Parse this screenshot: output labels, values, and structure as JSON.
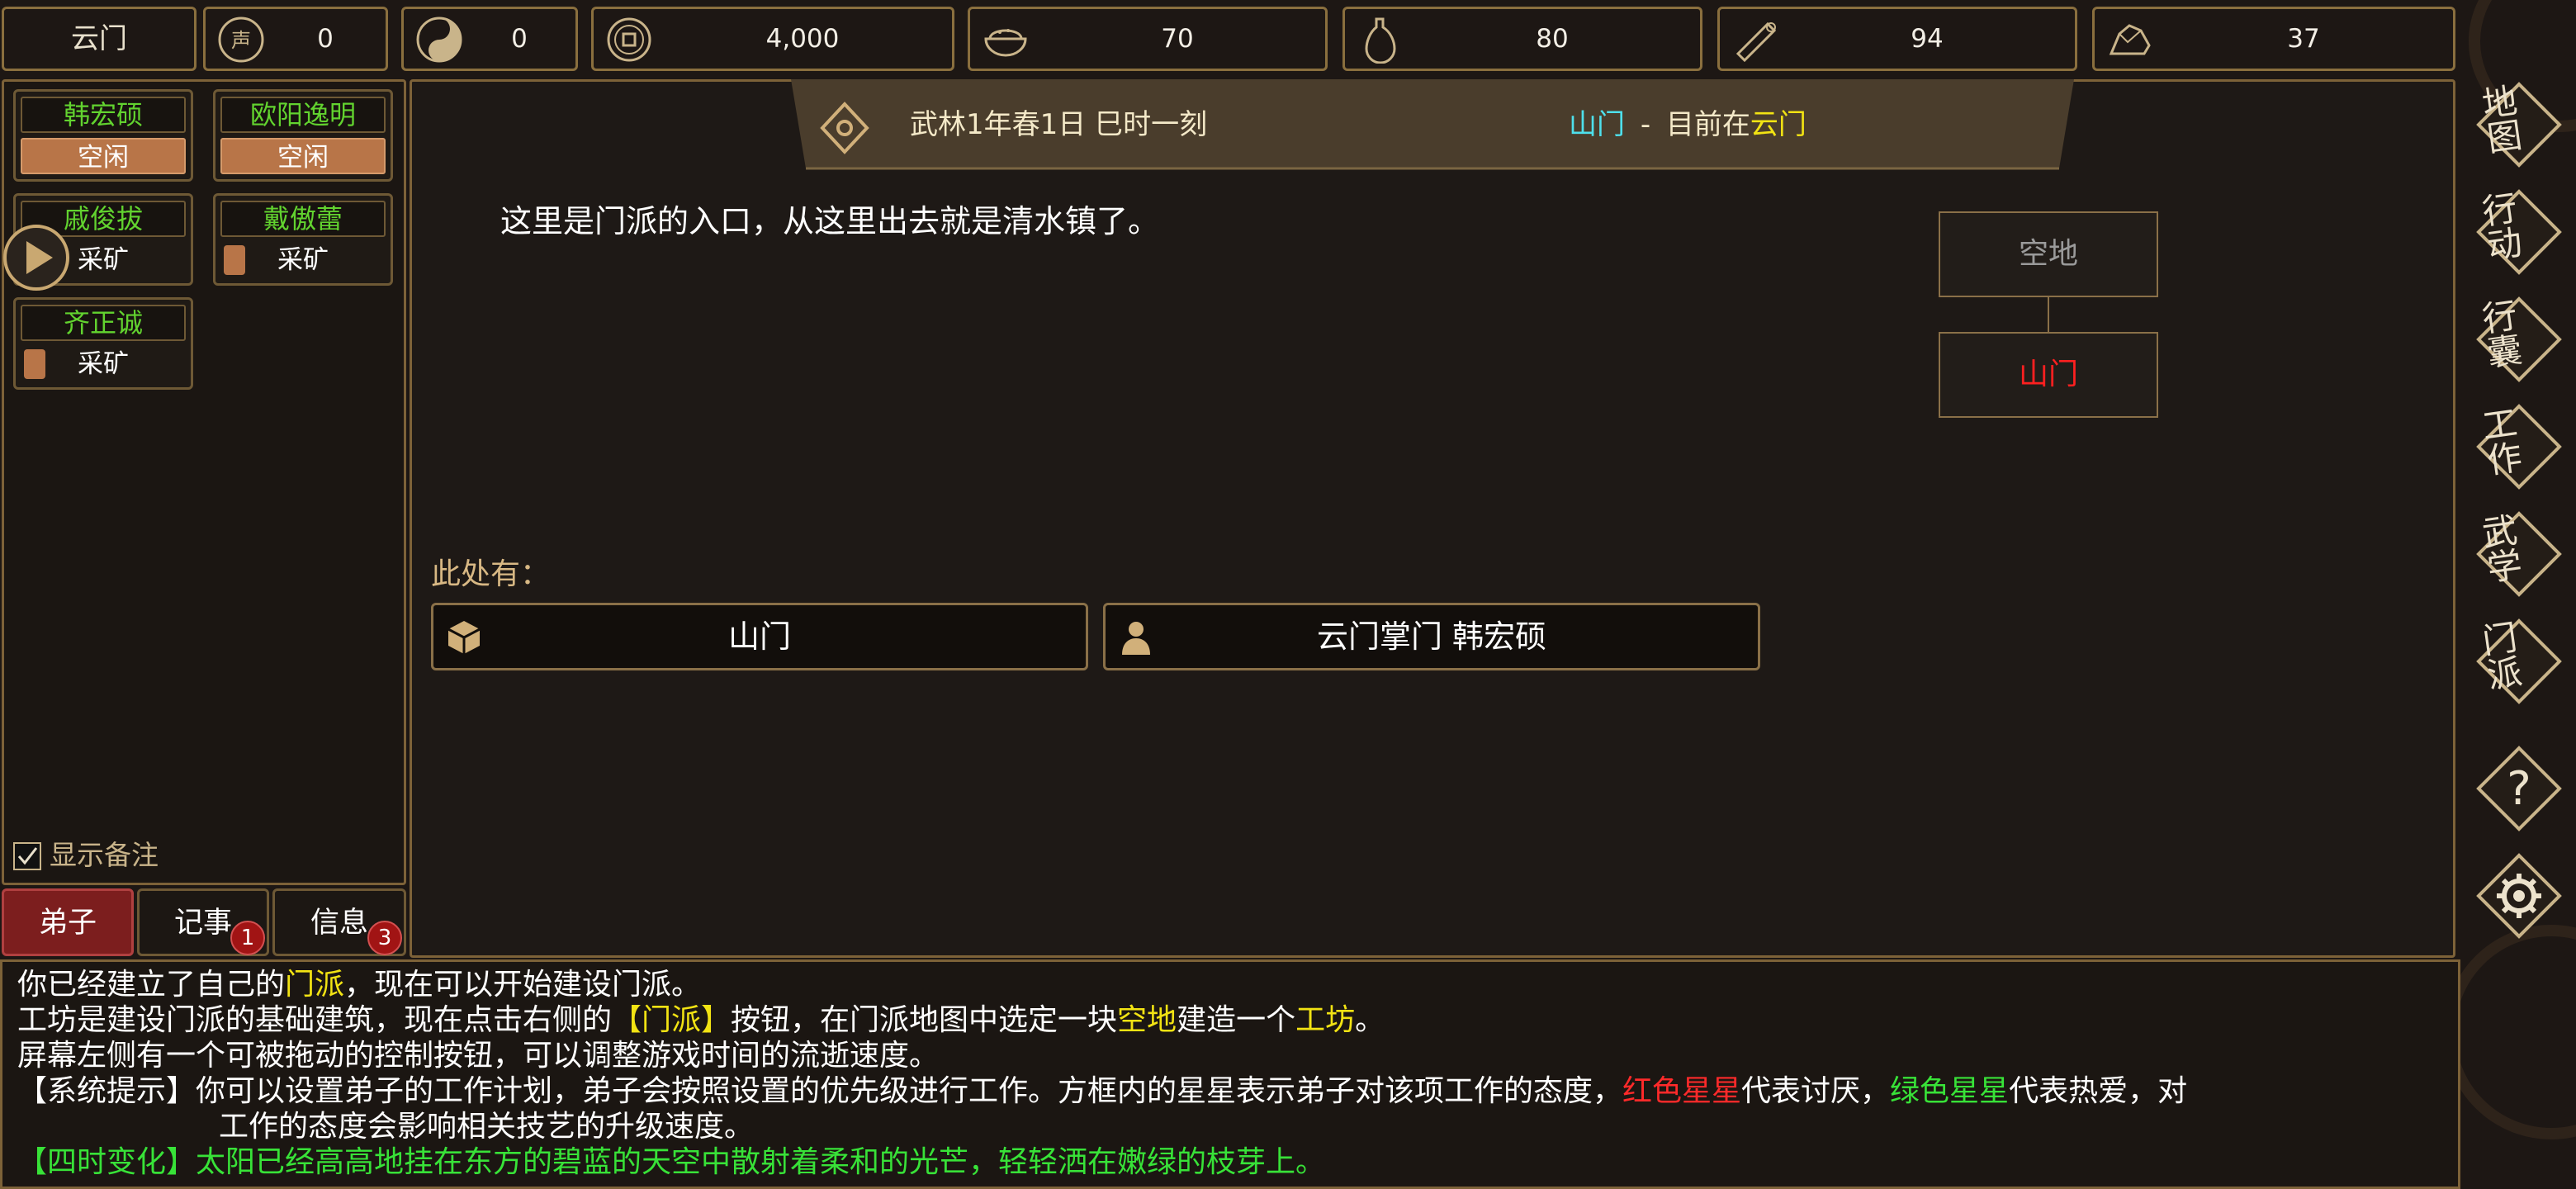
{
  "resources": {
    "sect": "云门",
    "prestige": "0",
    "yinyang": "0",
    "coins": "4,000",
    "food": "70",
    "herbs": "80",
    "wood": "94",
    "ore": "37"
  },
  "disciples": [
    {
      "name": "韩宏硕",
      "status": "空闲"
    },
    {
      "name": "欧阳逸明",
      "status": "空闲"
    },
    {
      "name": "戚俊拔",
      "status": "采矿"
    },
    {
      "name": "戴傲蕾",
      "status": "采矿"
    },
    {
      "name": "齐正诚",
      "status": "采矿"
    }
  ],
  "show_notes_label": "显示备注",
  "tabs": [
    {
      "label": "弟子"
    },
    {
      "label": "记事",
      "badge": "1"
    },
    {
      "label": "信息",
      "badge": "3"
    }
  ],
  "header": {
    "date": "武林1年春1日 巳时一刻",
    "location": "山门",
    "separator": "-",
    "current_prefix": "目前在",
    "current_place": "云门"
  },
  "description": "这里是门派的入口，从这里出去就是清水镇了。",
  "map_nodes": [
    "空地",
    "山门"
  ],
  "here_label": "此处有：",
  "entries": [
    {
      "icon": "cube-icon",
      "label": "山门"
    },
    {
      "icon": "person-icon",
      "label": "云门掌门 韩宏硕"
    }
  ],
  "side_menu": [
    "地图",
    "行动",
    "行囊",
    "工作",
    "武学",
    "门派",
    "help",
    "settings"
  ],
  "log": {
    "l1a": "你已经建立了自己的",
    "l1b": "门派",
    "l1c": "，现在可以开始建设门派。",
    "l2a": "工坊是建设门派的基础建筑，现在点击右侧的",
    "l2b": "【门派】",
    "l2c": "按钮，在门派地图中选定一块",
    "l2d": "空地",
    "l2e": "建造一个",
    "l2f": "工坊",
    "l2g": "。",
    "l3": "屏幕左侧有一个可被拖动的控制按钮，可以调整游戏时间的流逝速度。",
    "l4a": "【系统提示】你可以设置弟子的工作计划，弟子会按照设置的优先级进行工作。方框内的星星表示弟子对该项工作的态度，",
    "l4b": "红色星星",
    "l4c": "代表讨厌，",
    "l4d": "绿色星星",
    "l4e": "代表热爱，对",
    "l5": "工作的态度会影响相关技艺的升级速度。",
    "l6": "【四时变化】太阳已经高高地挂在东方的碧蓝的天空中散射着柔和的光芒，轻轻洒在嫩绿的枝芽上。"
  },
  "colors": {
    "accent": "#8a6f3e",
    "green": "#62d32f",
    "yellow": "#f2e313",
    "red": "#ff2a2a",
    "cyan": "#4ee0ec",
    "idle": "#b87548"
  }
}
